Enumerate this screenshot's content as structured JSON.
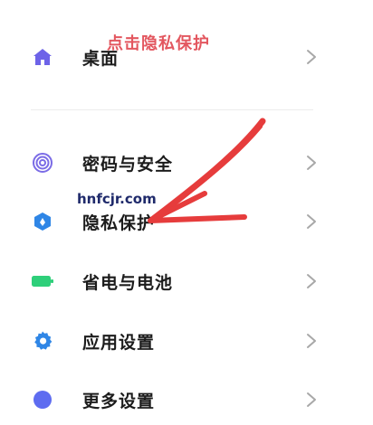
{
  "annotation": {
    "text": "点击隐私保护",
    "color": "#e3575f"
  },
  "watermark": "hnfcjr.com",
  "settings": {
    "items": [
      {
        "label": "桌面",
        "icon": "home-icon",
        "icon_color": "#6d63e8"
      },
      {
        "label": "密码与安全",
        "icon": "fingerprint-icon",
        "icon_color": "#7b6ce6"
      },
      {
        "label": "隐私保护",
        "icon": "privacy-shield-icon",
        "icon_color": "#2f86e6"
      },
      {
        "label": "省电与电池",
        "icon": "battery-icon",
        "icon_color": "#2ecf7a"
      },
      {
        "label": "应用设置",
        "icon": "gear-icon",
        "icon_color": "#2f86e6"
      },
      {
        "label": "更多设置",
        "icon": "more-settings-icon",
        "icon_color": "#5e6cf0"
      }
    ]
  }
}
